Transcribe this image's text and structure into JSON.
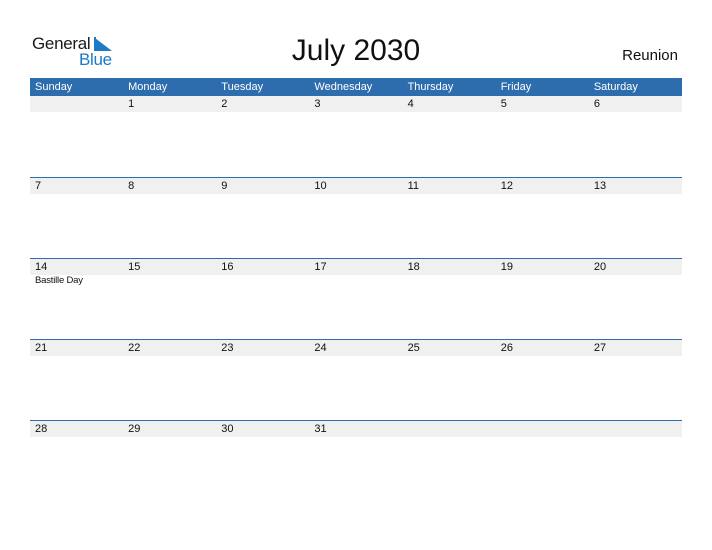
{
  "logo": {
    "word1": "General",
    "word2": "Blue"
  },
  "title": "July 2030",
  "country": "Reunion",
  "colors": {
    "accent": "#2e6dad",
    "logo_blue": "#1e7ac4",
    "day_bar": "#f0f0f0"
  },
  "weekdays": [
    "Sunday",
    "Monday",
    "Tuesday",
    "Wednesday",
    "Thursday",
    "Friday",
    "Saturday"
  ],
  "weeks": [
    {
      "days": [
        "",
        "1",
        "2",
        "3",
        "4",
        "5",
        "6"
      ],
      "events": [
        "",
        "",
        "",
        "",
        "",
        "",
        ""
      ]
    },
    {
      "days": [
        "7",
        "8",
        "9",
        "10",
        "11",
        "12",
        "13"
      ],
      "events": [
        "",
        "",
        "",
        "",
        "",
        "",
        ""
      ]
    },
    {
      "days": [
        "14",
        "15",
        "16",
        "17",
        "18",
        "19",
        "20"
      ],
      "events": [
        "Bastille Day",
        "",
        "",
        "",
        "",
        "",
        ""
      ]
    },
    {
      "days": [
        "21",
        "22",
        "23",
        "24",
        "25",
        "26",
        "27"
      ],
      "events": [
        "",
        "",
        "",
        "",
        "",
        "",
        ""
      ]
    },
    {
      "days": [
        "28",
        "29",
        "30",
        "31",
        "",
        "",
        ""
      ],
      "events": [
        "",
        "",
        "",
        "",
        "",
        "",
        ""
      ]
    }
  ]
}
